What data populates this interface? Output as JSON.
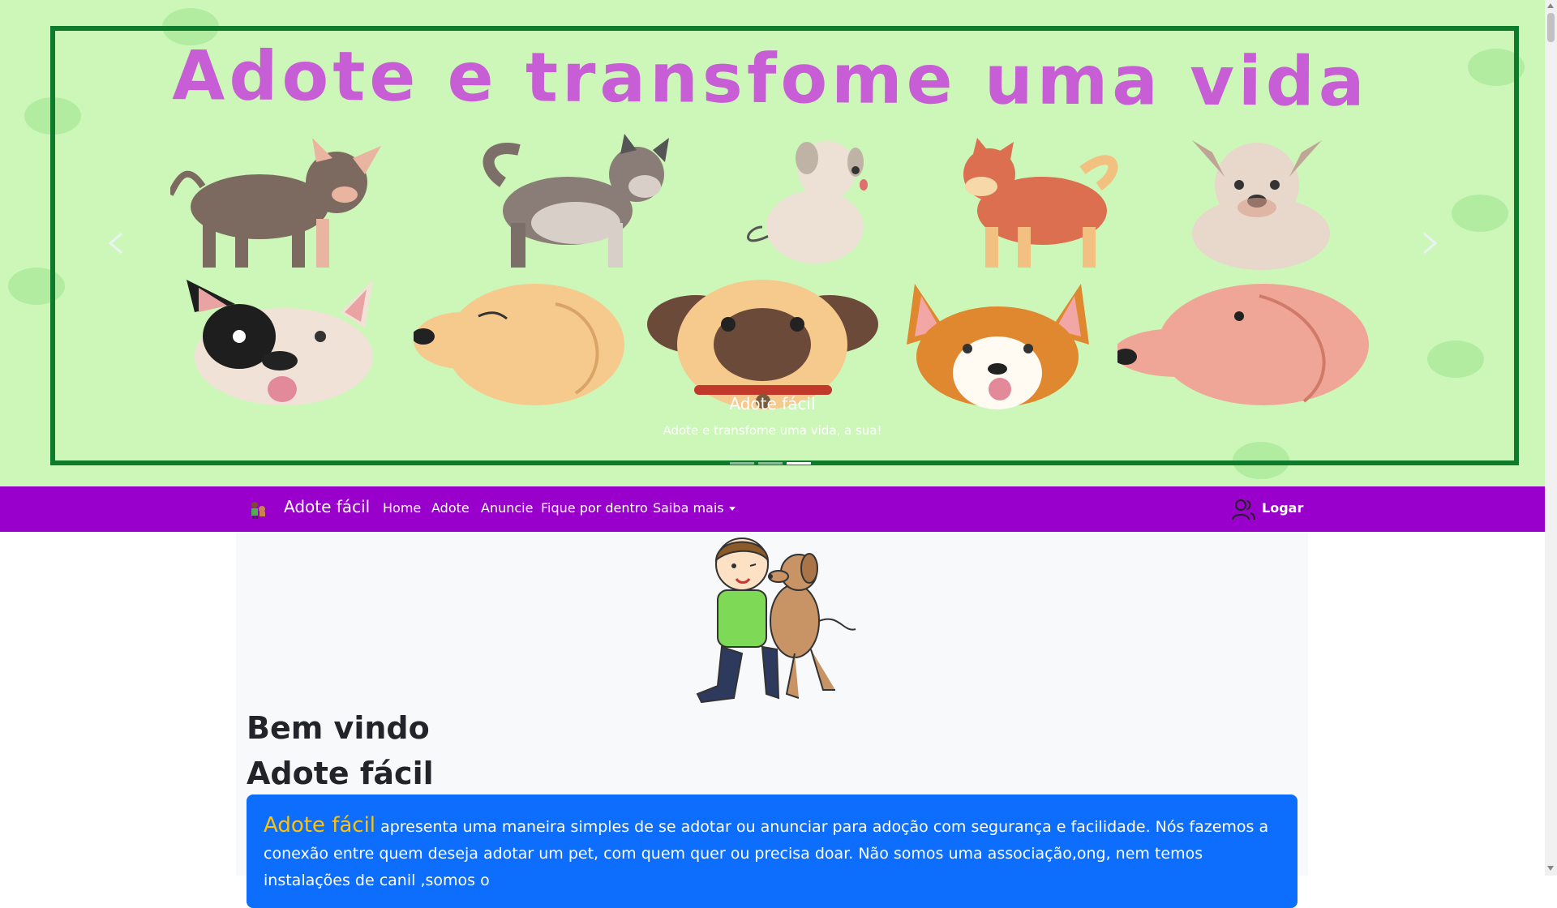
{
  "carousel": {
    "banner_title": "Adote e transfome uma vida",
    "caption_title": "Adote fácil",
    "caption_subtitle": "Adote e transfome uma vida, a sua!",
    "slide_count": 3,
    "active_slide": 3,
    "prev_icon": "chevron-left-icon",
    "next_icon": "chevron-right-icon",
    "background_color": "#ccf7b8",
    "frame_color": "#0e7a2c",
    "title_color": "#c75ed6"
  },
  "navbar": {
    "brand": "Adote fácil",
    "brand_icon": "family-pet-icon",
    "links": [
      "Home",
      "Adote",
      "Anuncie",
      "Fique por dentro"
    ],
    "dropdown_label": "Saiba mais",
    "login_label": "Logar",
    "login_icon": "users-icon",
    "background_color": "#9900cc"
  },
  "main": {
    "welcome": "Bem vindo",
    "site_name": "Adote fácil",
    "info_brand": "Adote fácil",
    "info_text": "apresenta uma maneira simples de se adotar ou anunciar para adoção com segurança e facilidade. Nós fazemos a conexão entre quem deseja adotar um pet, com quem quer ou precisa doar. Não somos uma associação,ong, nem temos instalações de canil ,somos o",
    "info_box_color": "#0d6efd",
    "info_brand_color": "#ffc107"
  }
}
